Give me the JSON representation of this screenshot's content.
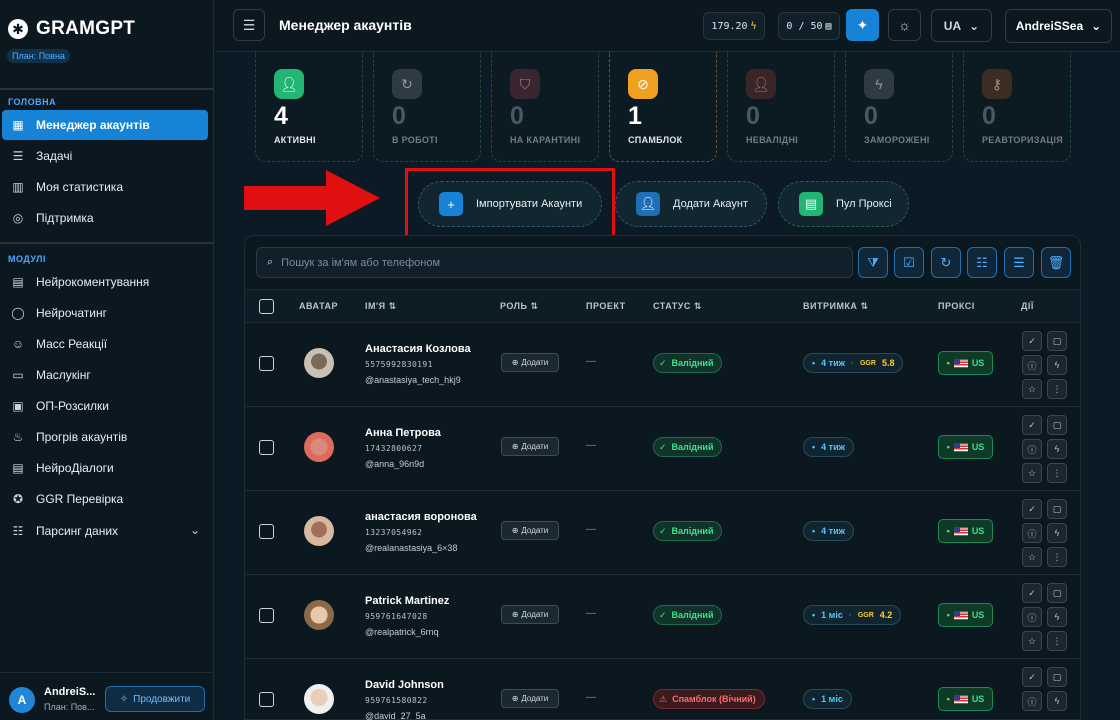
{
  "brand": {
    "name": "GRAMGPT",
    "plan": "План: Повна"
  },
  "sidebar": {
    "section_main": "ГОЛОВНА",
    "main_items": [
      {
        "label": "Менеджер акаунтів",
        "icon": "dashboard-icon",
        "active": true
      },
      {
        "label": "Задачі",
        "icon": "list-icon"
      },
      {
        "label": "Моя статистика",
        "icon": "chart-icon"
      },
      {
        "label": "Підтримка",
        "icon": "globe-icon"
      }
    ],
    "section_modules": "МОДУЛІ",
    "module_items": [
      {
        "label": "Нейрокоментування",
        "icon": "comments-icon"
      },
      {
        "label": "Нейрочатинг",
        "icon": "chat-icon"
      },
      {
        "label": "Масс Реакції",
        "icon": "smile-icon"
      },
      {
        "label": "Маслукінг",
        "icon": "monitor-icon"
      },
      {
        "label": "ОП-Розсилки",
        "icon": "message-icon"
      },
      {
        "label": "Прогрів акаунтів",
        "icon": "fire-icon"
      },
      {
        "label": "НейроДіалоги",
        "icon": "dialog-icon"
      },
      {
        "label": "GGR Перевірка",
        "icon": "star-icon"
      },
      {
        "label": "Парсинг даних",
        "icon": "database-icon"
      }
    ],
    "user": {
      "initial": "A",
      "name": "AndreiS...",
      "plan": "План: Пов...",
      "extend_label": "Продовжити"
    }
  },
  "topbar": {
    "title": "Менеджер акаунтів",
    "balance": "179.20",
    "quota": "0 / 50",
    "lang": "UA",
    "username": "AndreiSSea"
  },
  "stats": [
    {
      "value": "4",
      "label": "АКТИВНІ",
      "icon": "user-icon",
      "color": "#22b573"
    },
    {
      "value": "0",
      "label": "В РОБОТІ",
      "icon": "loading-icon",
      "color": "#3a4650"
    },
    {
      "value": "0",
      "label": "НА КАРАНТИНІ",
      "icon": "shield-icon",
      "color": "#4a2a34"
    },
    {
      "value": "1",
      "label": "СПАМБЛОК",
      "icon": "ban-icon",
      "color": "#f0a020"
    },
    {
      "value": "0",
      "label": "НЕВАЛІДНІ",
      "icon": "user-x-icon",
      "color": "#4a2a2c"
    },
    {
      "value": "0",
      "label": "ЗАМОРОЖЕНІ",
      "icon": "bolt-icon",
      "color": "#3a4650"
    },
    {
      "value": "0",
      "label": "РЕАВТОРИЗАЦІЯ",
      "icon": "key-icon",
      "color": "#4a3628"
    }
  ],
  "actions": {
    "import_label": "Імпортувати Акаунти",
    "add_label": "Додати Акаунт",
    "proxy_label": "Пул Проксі"
  },
  "search": {
    "placeholder": "Пошук за ім'ям або телефоном"
  },
  "table": {
    "columns": {
      "avatar": "АВАТАР",
      "name": "ІМ'Я",
      "role": "РОЛЬ",
      "project": "ПРОЕКТ",
      "status": "СТАТУС",
      "window": "ВИТРИМКА",
      "proxy": "ПРОКСІ",
      "actions": "ДІЇ"
    },
    "add_role_label": "Додати",
    "rows": [
      {
        "name": "Анастасия Козлова",
        "phone": "5575992830191",
        "username": "@anastasiya_tech_hkj9",
        "project": "—",
        "status": "Валідний",
        "status_type": "valid",
        "window": "4 тиж",
        "ggr_label": "GGR",
        "ggr": "5.8",
        "proxy": "US"
      },
      {
        "name": "Анна Петрова",
        "phone": "17432800627",
        "username": "@anna_96n9d",
        "project": "—",
        "status": "Валідний",
        "status_type": "valid",
        "window": "4 тиж",
        "ggr_label": "",
        "ggr": "",
        "proxy": "US"
      },
      {
        "name": "анастасия воронова",
        "phone": "13237054962",
        "username": "@realanastasiya_6×38",
        "project": "—",
        "status": "Валідний",
        "status_type": "valid",
        "window": "4 тиж",
        "ggr_label": "",
        "ggr": "",
        "proxy": "US"
      },
      {
        "name": "Patrick Martinez",
        "phone": "959761647028",
        "username": "@realpatrick_6rnq",
        "project": "—",
        "status": "Валідний",
        "status_type": "valid",
        "window": "1 міс",
        "ggr_label": "GGR",
        "ggr": "4.2",
        "proxy": "US"
      },
      {
        "name": "David Johnson",
        "phone": "959761580822",
        "username": "@david_27_5a",
        "project": "—",
        "status": "Спамблок (Вічний)",
        "status_type": "spam",
        "window": "1 міс",
        "ggr_label": "",
        "ggr": "",
        "proxy": "US"
      }
    ]
  },
  "colors": {
    "accent": "#1683d6",
    "valid": "#3ee08a",
    "spam": "#ff6b6b",
    "highlight_frame": "#e01010"
  }
}
